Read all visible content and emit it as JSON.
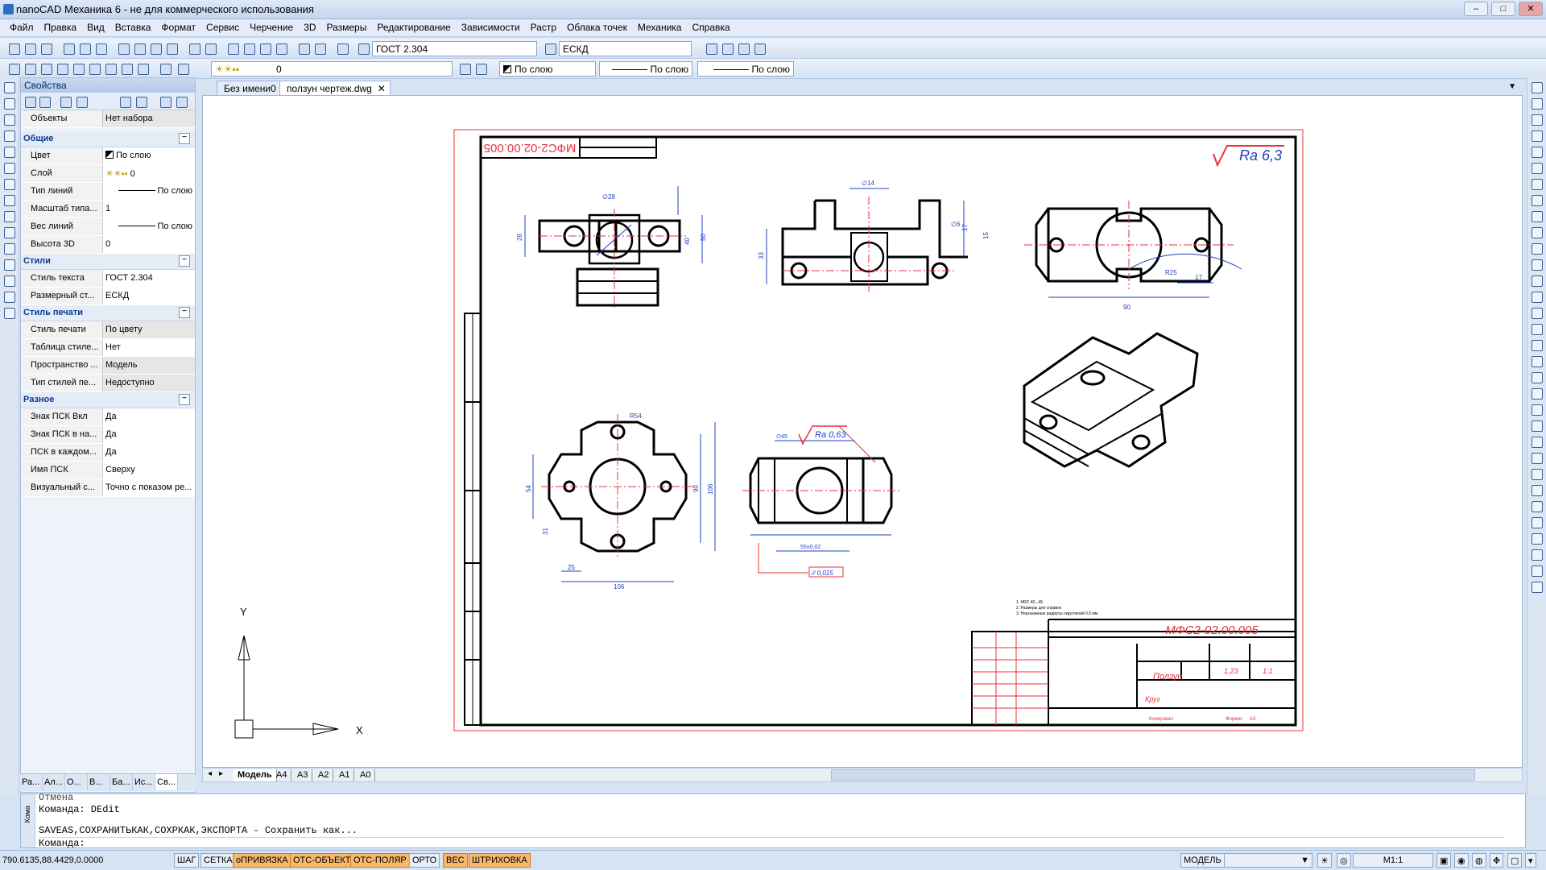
{
  "window": {
    "title": "nanoCAD Механика 6 - не для коммерческого использования",
    "controls": [
      "–",
      "□",
      "✕"
    ]
  },
  "menu": [
    "Файл",
    "Правка",
    "Вид",
    "Вставка",
    "Формат",
    "Сервис",
    "Черчение",
    "3D",
    "Размеры",
    "Редактирование",
    "Зависимости",
    "Растр",
    "Облака точек",
    "Механика",
    "Справка"
  ],
  "toolbar1": {
    "text_style": "ГОСТ 2.304",
    "dim_style": "ЕСКД"
  },
  "toolbar2": {
    "layer": "0",
    "color": "По слою",
    "linetype": "По слою",
    "lineweight": "По слою"
  },
  "properties": {
    "title": "Свойства",
    "objects_label": "Объекты",
    "objects_value": "Нет набора",
    "sections": [
      {
        "name": "Общие",
        "rows": [
          {
            "k": "Цвет",
            "v": "По слою"
          },
          {
            "k": "Слой",
            "v": "0"
          },
          {
            "k": "Тип линий",
            "v": "По слою"
          },
          {
            "k": "Масштаб типа...",
            "v": "1"
          },
          {
            "k": "Вес линий",
            "v": "По слою"
          },
          {
            "k": "Высота 3D",
            "v": "0"
          }
        ]
      },
      {
        "name": "Стили",
        "rows": [
          {
            "k": "Стиль текста",
            "v": "ГОСТ 2.304"
          },
          {
            "k": "Размерный ст...",
            "v": "ЕСКД"
          }
        ]
      },
      {
        "name": "Стиль печати",
        "rows": [
          {
            "k": "Стиль печати",
            "v": "По цвету"
          },
          {
            "k": "Таблица стиле...",
            "v": "Нет"
          },
          {
            "k": "Пространство ...",
            "v": "Модель"
          },
          {
            "k": "Тип стилей пе...",
            "v": "Недоступно"
          }
        ]
      },
      {
        "name": "Разное",
        "rows": [
          {
            "k": "Знак ПСК Вкл",
            "v": "Да"
          },
          {
            "k": "Знак ПСК в на...",
            "v": "Да"
          },
          {
            "k": "ПСК в каждом...",
            "v": "Да"
          },
          {
            "k": "Имя ПСК",
            "v": "Сверху"
          },
          {
            "k": "Визуальный с...",
            "v": "Точно с показом ре..."
          }
        ]
      }
    ],
    "bottom_tabs": [
      "Ра...",
      "Ал...",
      "О...",
      "В...",
      "Ба...",
      "Ис...",
      "Св..."
    ]
  },
  "doc_tabs": [
    {
      "label": "Без имени0"
    },
    {
      "label": "ползун чертеж.dwg"
    }
  ],
  "layout_tabs": [
    "Модель",
    "A4",
    "A3",
    "A2",
    "A1",
    "A0"
  ],
  "drawing": {
    "roughness_main": "Ra 6,3",
    "roughness_local": "Ra 0,63",
    "stamp_code": "МФС2-02.00.005",
    "stamp_mirror": "МФС2-02.00.005",
    "part_name": "Ползун",
    "material": "Круг",
    "scale": "1:1",
    "mass": "1,23",
    "copied": "Копировал",
    "format": "Формат",
    "format_value": "A3",
    "dims": [
      "∅28",
      "50",
      "40",
      "26",
      "∅14",
      "33",
      "17",
      "15",
      "∅6",
      "90",
      "17",
      "R25",
      "R54",
      "54",
      "90",
      "106",
      "106",
      "25",
      "31",
      "∅45",
      "55±0,02"
    ],
    "notes": [
      "1. HRC 40...45",
      "2. Размеры для справок",
      "3. Неуказанные радиусы скруглений 0,5 мм"
    ],
    "tolerance": "// 0,015",
    "ucs_y": "Y",
    "ucs_x": "X"
  },
  "command": {
    "lines": [
      "Отмена",
      "Команда: DEdit",
      "",
      "SAVEAS,СОХРАНИТЬКАК,СОХРКАК,ЭКСПОРТА - Сохранить как...",
      "Команда:"
    ],
    "side_label": "Кома"
  },
  "status": {
    "coords": "790.6135,88.4429,0.0000",
    "toggles": [
      {
        "label": "ШАГ",
        "on": false
      },
      {
        "label": "СЕТКА",
        "on": false
      },
      {
        "label": "оПРИВЯЗКА",
        "on": true
      },
      {
        "label": "ОТС-ОБЪЕКТ",
        "on": true
      },
      {
        "label": "ОТС-ПОЛЯР",
        "on": true
      },
      {
        "label": "ОРТО",
        "on": false
      },
      {
        "label": "ВЕС",
        "on": true
      },
      {
        "label": "ШТРИХОВКА",
        "on": true
      }
    ],
    "space": "МОДЕЛЬ",
    "scale": "M1:1"
  },
  "colors": {
    "accent": "#2f6dbf",
    "frame_red": "#e8323c",
    "dim_blue": "#1f3fbf",
    "toggle_on": "#f7b86b"
  }
}
